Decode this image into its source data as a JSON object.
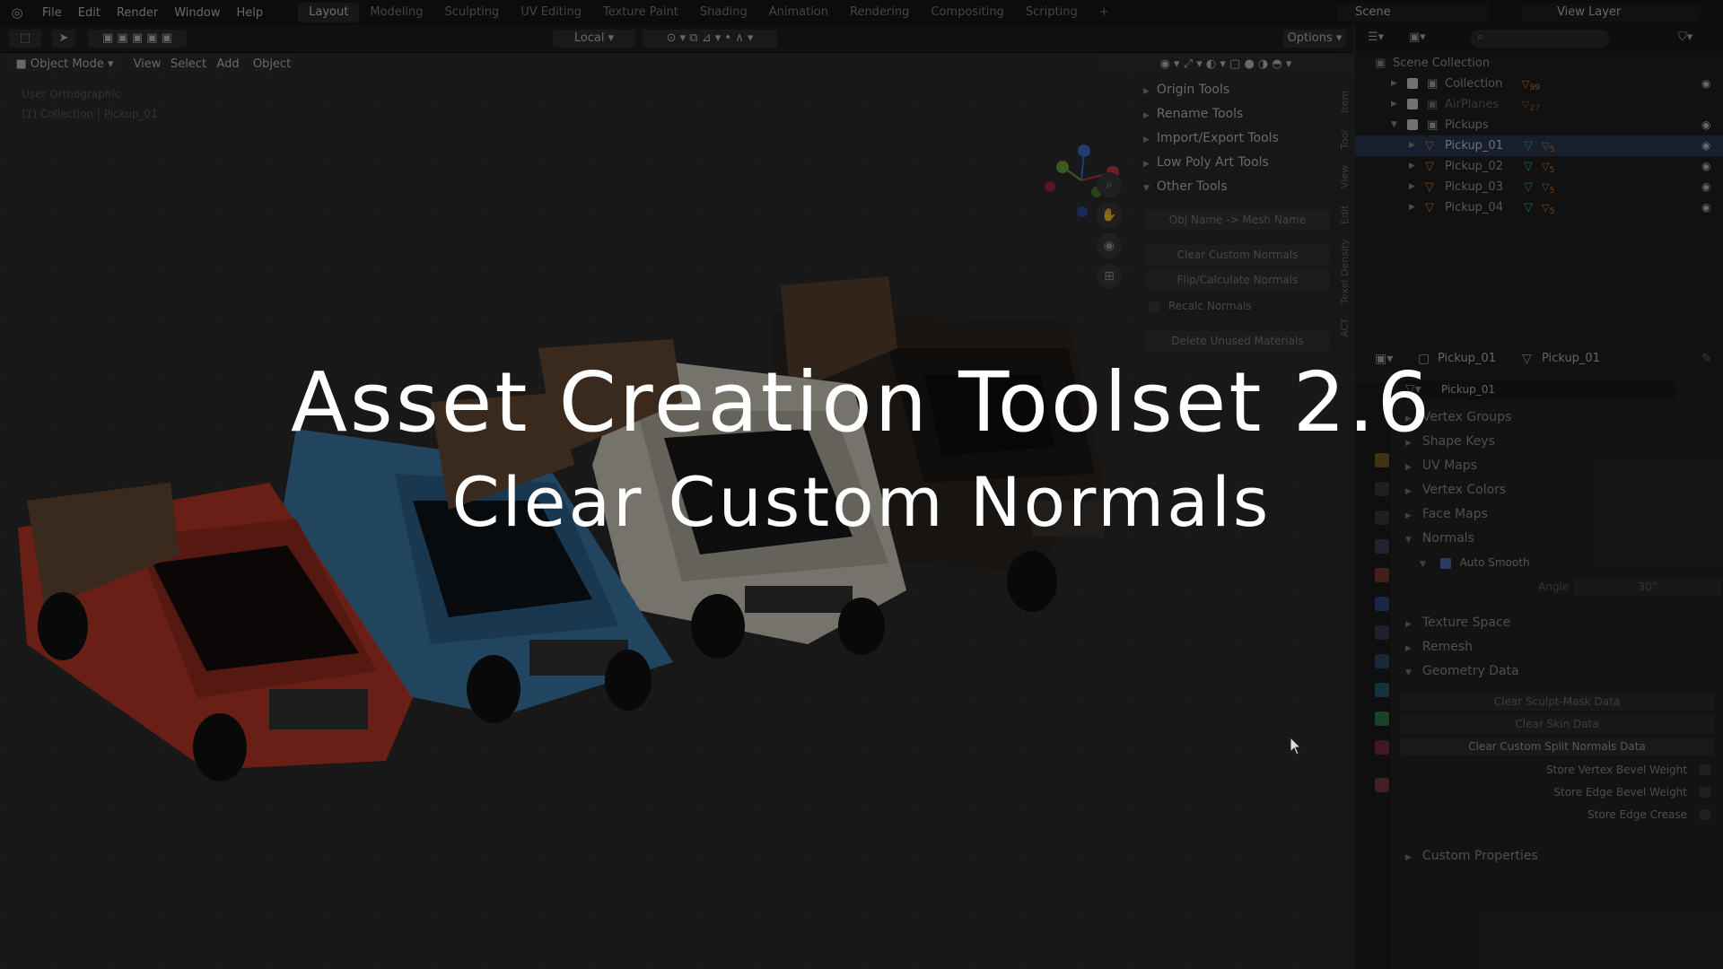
{
  "menu": {
    "items": [
      "File",
      "Edit",
      "Render",
      "Window",
      "Help"
    ]
  },
  "workspaces": [
    "Layout",
    "Modeling",
    "Sculpting",
    "UV Editing",
    "Texture Paint",
    "Shading",
    "Animation",
    "Rendering",
    "Compositing",
    "Scripting"
  ],
  "topbar": {
    "scene": "Scene",
    "view_layer": "View Layer"
  },
  "viewport_header": {
    "transform_orientation": "Local",
    "options": "Options",
    "mode": "Object Mode",
    "menus": [
      "View",
      "Select",
      "Add",
      "Object"
    ]
  },
  "viewport": {
    "view_name": "User Orthographic",
    "context": "(1) Collection | Pickup_01"
  },
  "npanel": {
    "sections": [
      "Origin Tools",
      "Rename Tools",
      "Import/Export Tools",
      "Low Poly Art Tools",
      "Other Tools"
    ],
    "buttons": [
      "Obj Name -> Mesh Name",
      "Clear Custom Normals",
      "Flip/Calculate Normals"
    ],
    "checkbox_label": "Recalc Normals",
    "delete_button": "Delete Unused Materials",
    "tabs": [
      "Item",
      "Tool",
      "View",
      "Edit",
      "Texel Density",
      "ACT"
    ]
  },
  "outliner": {
    "root": "Scene Collection",
    "rows": [
      {
        "label": "Collection",
        "badge": "99"
      },
      {
        "label": "AirPlanes",
        "badge": "27"
      },
      {
        "label": "Pickups",
        "badge": ""
      },
      {
        "label": "Pickup_01",
        "badge": "5"
      },
      {
        "label": "Pickup_02",
        "badge": "5"
      },
      {
        "label": "Pickup_03",
        "badge": "5"
      },
      {
        "label": "Pickup_04",
        "badge": "5"
      }
    ]
  },
  "properties": {
    "object_name": "Pickup_01",
    "mesh_name": "Pickup_01",
    "data_name": "Pickup_01",
    "sections": [
      "Vertex Groups",
      "Shape Keys",
      "UV Maps",
      "Vertex Colors",
      "Face Maps",
      "Normals"
    ],
    "auto_smooth": "Auto Smooth",
    "angle_label": "Angle",
    "angle_value": "30°",
    "sections2": [
      "Texture Space",
      "Remesh",
      "Geometry Data"
    ],
    "geometry_buttons": [
      "Clear Sculpt-Mask Data",
      "Clear Skin Data",
      "Clear Custom Split Normals Data"
    ],
    "store_options": [
      "Store Vertex Bevel Weight",
      "Store Edge Bevel Weight",
      "Store Edge Crease"
    ],
    "custom_properties": "Custom Properties"
  },
  "overlay": {
    "title": "Asset Creation Toolset 2.6",
    "subtitle": "Clear Custom Normals"
  },
  "colors": {
    "truck_red": "#c23a28",
    "truck_blue": "#3f7fae",
    "truck_white": "#d8d2c6",
    "truck_black": "#2a2622",
    "accent_blue": "#4772b3"
  }
}
